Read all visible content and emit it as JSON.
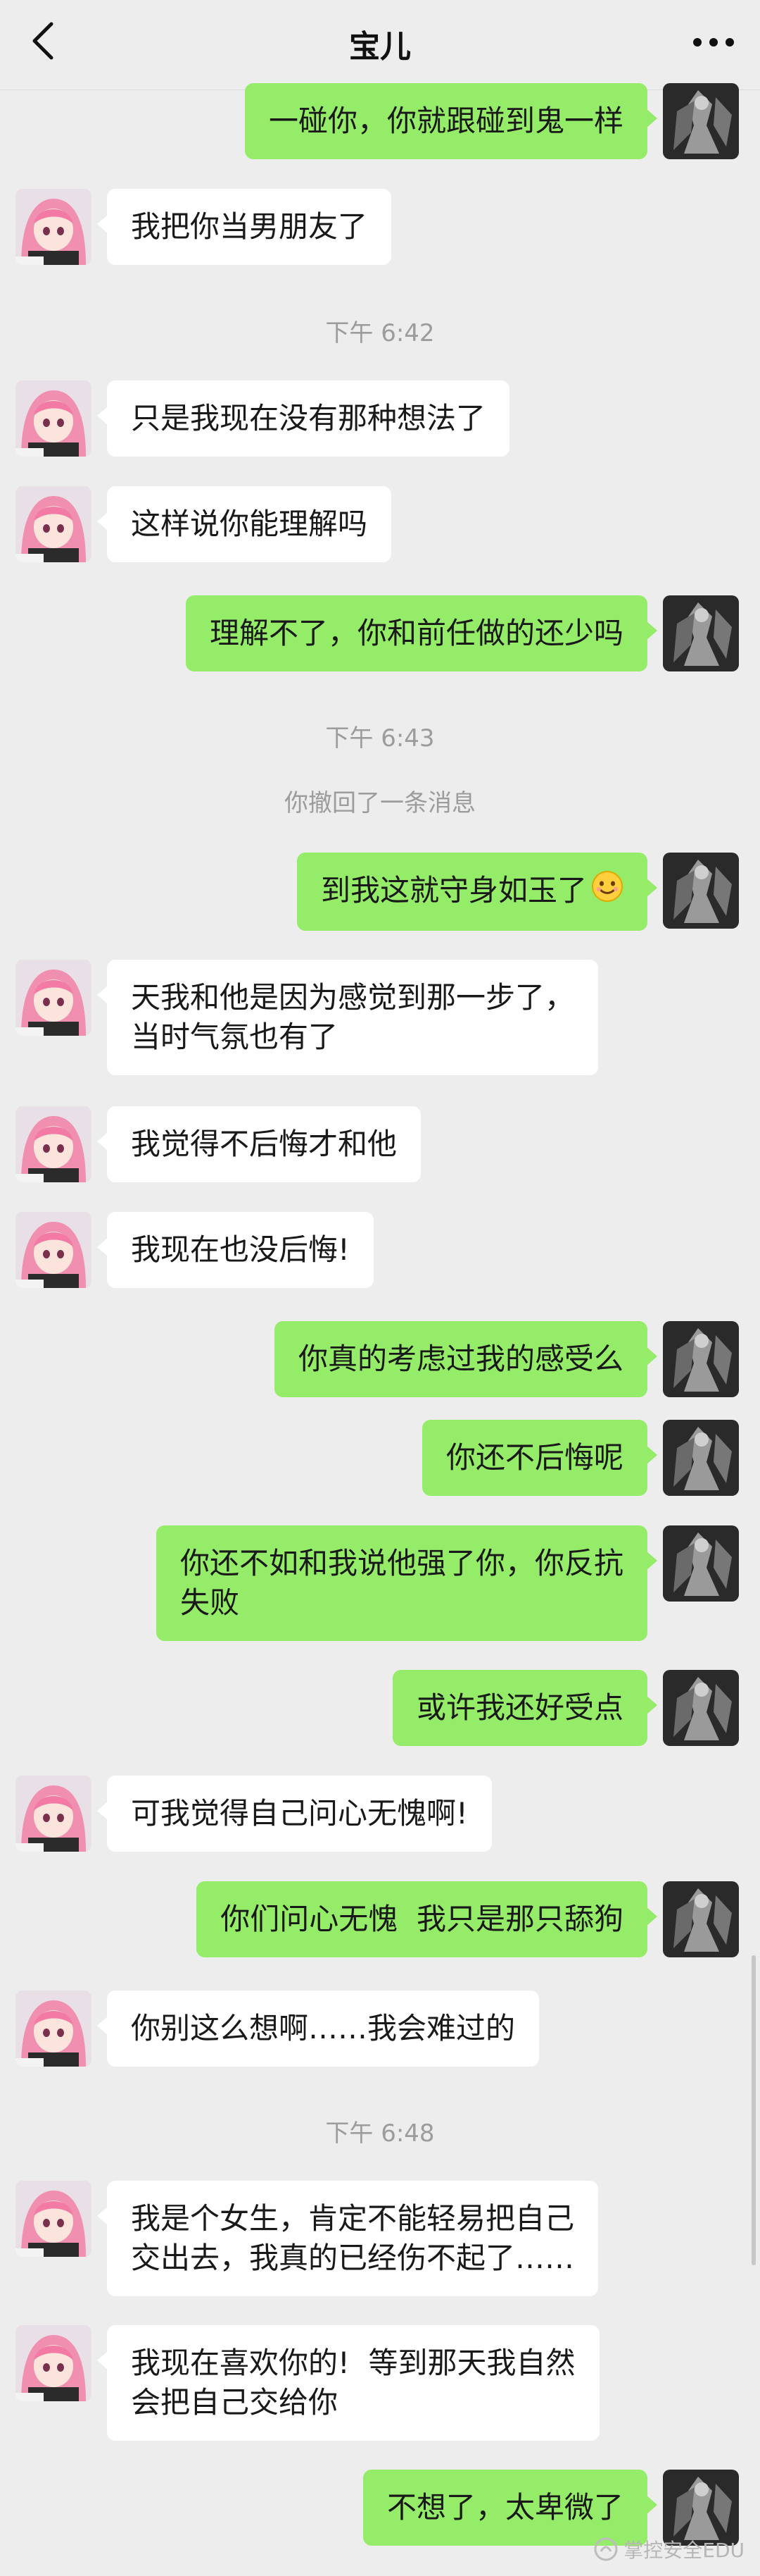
{
  "header": {
    "title": "宝儿"
  },
  "messages": [
    {
      "from": "me",
      "text": "一碰你，你就跟碰到鬼一样"
    },
    {
      "from": "her",
      "text": "我把你当男朋友了"
    },
    {
      "from": "time",
      "text": "下午 6:42"
    },
    {
      "from": "her",
      "text": "只是我现在没有那种想法了"
    },
    {
      "from": "her",
      "text": "这样说你能理解吗"
    },
    {
      "from": "me",
      "text": "理解不了，你和前任做的还少吗"
    },
    {
      "from": "time",
      "text": "下午 6:43"
    },
    {
      "from": "system",
      "text": "你撤回了一条消息"
    },
    {
      "from": "me",
      "text": "到我这就守身如玉了"
    },
    {
      "from": "her",
      "text": "天我和他是因为感觉到那一步了，\n当时气氛也有了"
    },
    {
      "from": "her",
      "text": "我觉得不后悔才和他"
    },
    {
      "from": "her",
      "text": "我现在也没后悔!"
    },
    {
      "from": "me",
      "text": "你真的考虑过我的感受么"
    },
    {
      "from": "me",
      "text": "你还不后悔呢"
    },
    {
      "from": "me",
      "text": "你还不如和我说他强了你，你反抗\n失败"
    },
    {
      "from": "me",
      "text": "或许我还好受点"
    },
    {
      "from": "her",
      "text": "可我觉得自己问心无愧啊!"
    },
    {
      "from": "me",
      "text": "你们问心无愧  我只是那只舔狗"
    },
    {
      "from": "her",
      "text": "你别这么想啊……我会难过的"
    },
    {
      "from": "time",
      "text": "下午 6:48"
    },
    {
      "from": "her",
      "text": "我是个女生，肯定不能轻易把自己\n交出去，我真的已经伤不起了……"
    },
    {
      "from": "her",
      "text": "我现在喜欢你的!  等到那天我自然\n会把自己交给你"
    },
    {
      "from": "me",
      "text": "不想了，太卑微了"
    }
  ],
  "watermark": {
    "text": "掌控安全EDU"
  },
  "colors": {
    "me_bubble": "#95ec69",
    "her_bubble": "#ffffff",
    "background": "#ededed"
  },
  "icons": {
    "back": "chevron-left-icon",
    "more": "more-dots-icon",
    "emoji": "smile-emoji-icon"
  }
}
